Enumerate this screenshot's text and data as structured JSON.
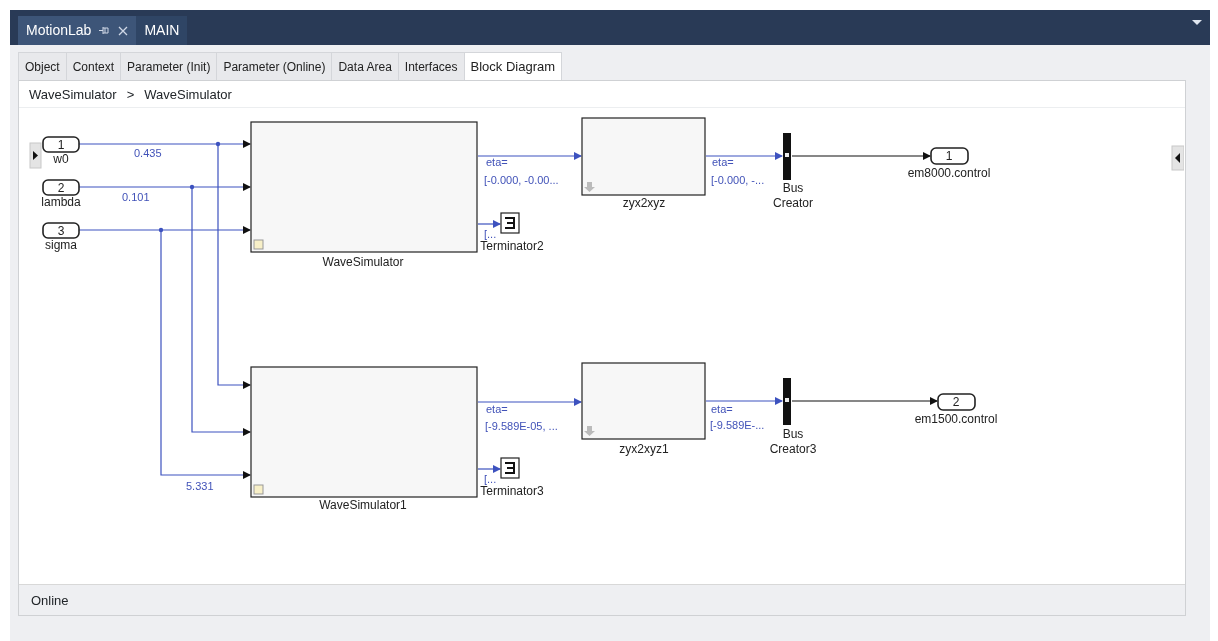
{
  "document_tabs": [
    {
      "label": "MotionLab",
      "selected": true
    },
    {
      "label": "MAIN",
      "selected": false
    }
  ],
  "editor_tabs": [
    {
      "label": "Object",
      "selected": false
    },
    {
      "label": "Context",
      "selected": false
    },
    {
      "label": "Parameter (Init)",
      "selected": false
    },
    {
      "label": "Parameter (Online)",
      "selected": false
    },
    {
      "label": "Data Area",
      "selected": false
    },
    {
      "label": "Interfaces",
      "selected": false
    },
    {
      "label": "Block Diagram",
      "selected": true
    }
  ],
  "breadcrumb": [
    "WaveSimulator",
    ">",
    "WaveSimulator"
  ],
  "diagram": {
    "inports": [
      {
        "number": "1",
        "name": "w0"
      },
      {
        "number": "2",
        "name": "lambda"
      },
      {
        "number": "3",
        "name": "sigma"
      }
    ],
    "subsystems": [
      {
        "name": "WaveSimulator"
      },
      {
        "name": "zyx2xyz"
      },
      {
        "name": "WaveSimulator1"
      },
      {
        "name": "zyx2xyz1"
      }
    ],
    "terminators": [
      {
        "name": "Terminator2",
        "value": "[..."
      },
      {
        "name": "Terminator3",
        "value": "[..."
      }
    ],
    "bus_creators": [
      {
        "label_lines": [
          "Bus",
          "Creator"
        ]
      },
      {
        "label_lines": [
          "Bus",
          "Creator3"
        ]
      }
    ],
    "outports": [
      {
        "number": "1",
        "name": "em8000.control"
      },
      {
        "number": "2",
        "name": "em1500.control"
      }
    ],
    "value_labels": [
      "0.435",
      "0.101",
      "5.331"
    ],
    "eta_labels": [
      {
        "name": "eta=",
        "value": "[-0.000, -0.00..."
      },
      {
        "name": "eta=",
        "value": "[-0.000, -..."
      },
      {
        "name": "eta=",
        "value": "[-9.589E-05, ..."
      },
      {
        "name": "eta=",
        "value": "[-9.589E-..."
      }
    ]
  },
  "status_bar": "Online"
}
